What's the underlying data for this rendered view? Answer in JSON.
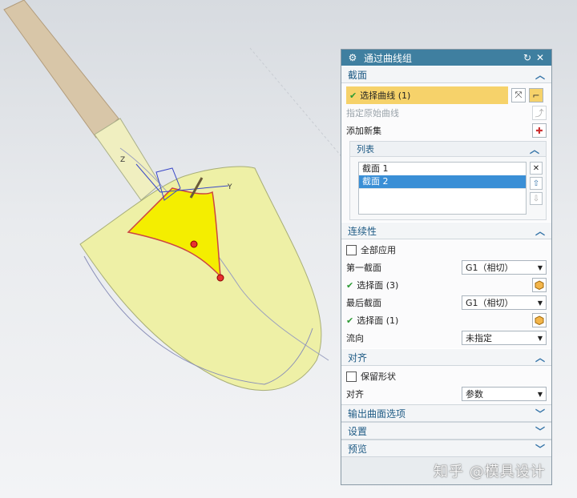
{
  "dialog": {
    "title": "通过曲线组",
    "section_section": {
      "header": "截面",
      "select_curve": "选择曲线 (1)",
      "specify_origin": "指定原始曲线",
      "add_new_set": "添加新集",
      "list": {
        "header": "列表",
        "items": [
          "截面 1",
          "截面 2"
        ],
        "selected_index": 1
      }
    },
    "continuity": {
      "header": "连续性",
      "apply_all": "全部应用",
      "first_section_label": "第一截面",
      "first_section_value": "G1（相切）",
      "first_select": "选择面 (3)",
      "last_section_label": "最后截面",
      "last_section_value": "G1（相切）",
      "last_select": "选择面 (1)",
      "flow_label": "流向",
      "flow_value": "未指定"
    },
    "alignment": {
      "header": "对齐",
      "preserve_shape": "保留形状",
      "align_label": "对齐",
      "align_value": "参数"
    },
    "collapsed_sections": [
      "输出曲面选项",
      "设置",
      "预览"
    ]
  },
  "watermark": "知乎 @模具设计",
  "colors": {
    "accent": "#3f7fa0",
    "selection_highlight": "#f6d26a",
    "list_selected": "#3a8fd6",
    "surface_yellow": "#eef0a6"
  }
}
